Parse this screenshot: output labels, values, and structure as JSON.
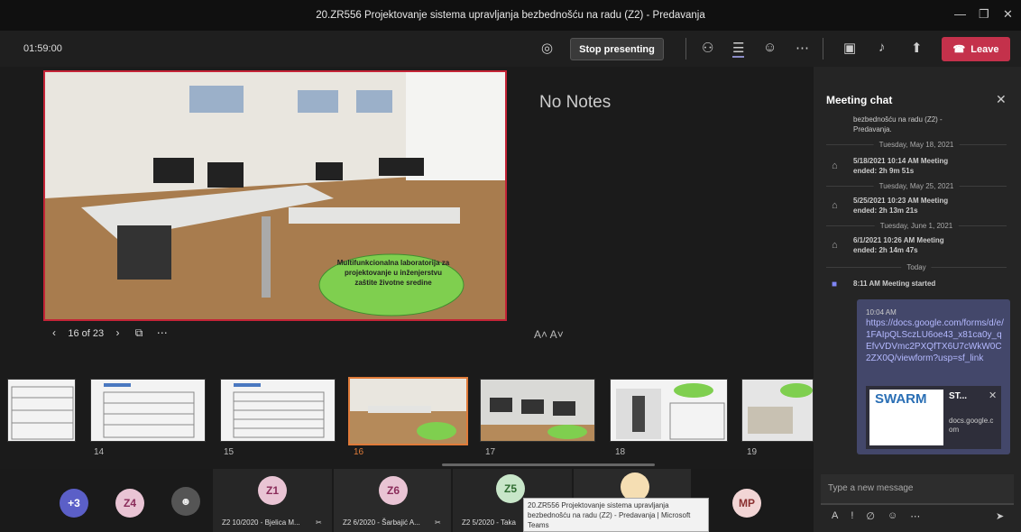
{
  "window": {
    "title": "20.ZR556 Projektovanje sistema upravljanja bezbednošću na radu (Z2) - Predavanja",
    "min_icon": "minimize-icon",
    "max_icon": "maximize-icon",
    "close_icon": "close-icon"
  },
  "toolbar": {
    "timer": "01:59:00",
    "stop_presenting": "Stop presenting",
    "leave": "Leave",
    "leave_color": "#c4314b"
  },
  "slide": {
    "text": "Multifunkcionalna laboratorija za projektovanje u inženjerstvu zaštite životne sredine",
    "position": "16 of 23",
    "notes": "No Notes",
    "font_buttons": "A˄  A˅"
  },
  "thumbnails": [
    "14",
    "15",
    "16",
    "17",
    "18",
    "19"
  ],
  "thumb_caption": "Multifunkcionalna laboratorija",
  "participants": {
    "more": "+3",
    "z4": "Z4",
    "z1": "Z1",
    "z6": "Z6",
    "z5": "Z5",
    "mp": "MP",
    "name1": "Z2 10/2020 - Bjelica M...",
    "name2": "Z2 6/2020 - Šarbajić A...",
    "name3": "Z2 5/2020 - Taka"
  },
  "tooltip": "20.ZR556 Projektovanje sistema upravljanja bezbednošću na radu (Z2) - Predavanja | Microsoft Teams",
  "chat": {
    "title": "Meeting chat",
    "top_text1": "bezbednošću na radu (Z2) -",
    "top_text2": "Predavanja.",
    "date1": "Tuesday, May 18, 2021",
    "entry1a": "5/18/2021 10:14 AM  Meeting",
    "entry1b": "ended: 2h 9m 51s",
    "date2": "Tuesday, May 25, 2021",
    "entry2a": "5/25/2021 10:23 AM  Meeting",
    "entry2b": "ended: 2h 13m 21s",
    "date3": "Tuesday, June 1, 2021",
    "entry3a": "6/1/2021 10:26 AM  Meeting",
    "entry3b": "ended: 2h 14m 47s",
    "date4": "Today",
    "started": "8:11 AM  Meeting started",
    "msg_time": "10:04 AM",
    "link": "https://docs.google.com/forms/d/e/1FAIpQLSczLU6oe43_x81ca0y_qEfvVDVmc2PXQfTX6U7cWkW0C2ZX0Q/viewform?usp=sf_link",
    "card_title": "ST...",
    "card_domain": "docs.google.com",
    "card_logo": "SWARM",
    "compose": "Type a new message"
  }
}
